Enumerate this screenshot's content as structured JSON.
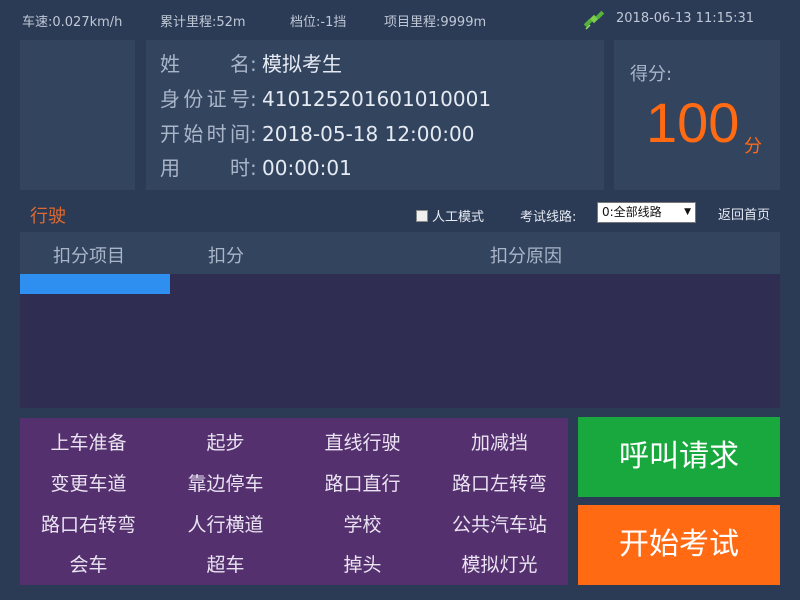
{
  "status": {
    "speed": "车速:0.027km/h",
    "mileage": "累计里程:52m",
    "gear": "档位:-1挡",
    "project_mileage": "项目里程:9999m",
    "datetime": "2018-06-13 11:15:31",
    "gps_icon": "satellite-icon"
  },
  "candidate": {
    "name_label": "姓名",
    "name_value": "模拟考生",
    "id_label": "身份证号",
    "id_value": "410125201601010001",
    "start_label": "开始时间",
    "start_value": "2018-05-18 12:00:00",
    "elapsed_label": "用时",
    "elapsed_value": "00:00:01",
    "colon": ":"
  },
  "score": {
    "label": "得分:",
    "value": "100",
    "unit": "分",
    "color": "#ff6a13"
  },
  "section": {
    "title": "行驶",
    "manual_mode_label": "人工模式",
    "manual_mode_checked": false,
    "route_label": "考试线路:",
    "route_selected": "0:全部线路",
    "back_label": "返回首页"
  },
  "deductions": {
    "columns": [
      "扣分项目",
      "扣分",
      "扣分原因"
    ],
    "rows": []
  },
  "items": [
    "上车准备",
    "起步",
    "直线行驶",
    "加减挡",
    "变更车道",
    "靠边停车",
    "路口直行",
    "路口左转弯",
    "路口右转弯",
    "人行横道",
    "学校",
    "公共汽车站",
    "会车",
    "超车",
    "掉头",
    "模拟灯光"
  ],
  "actions": {
    "call_label": "呼叫请求",
    "start_label": "开始考试",
    "call_color": "#18a83e",
    "start_color": "#ff6a13"
  }
}
